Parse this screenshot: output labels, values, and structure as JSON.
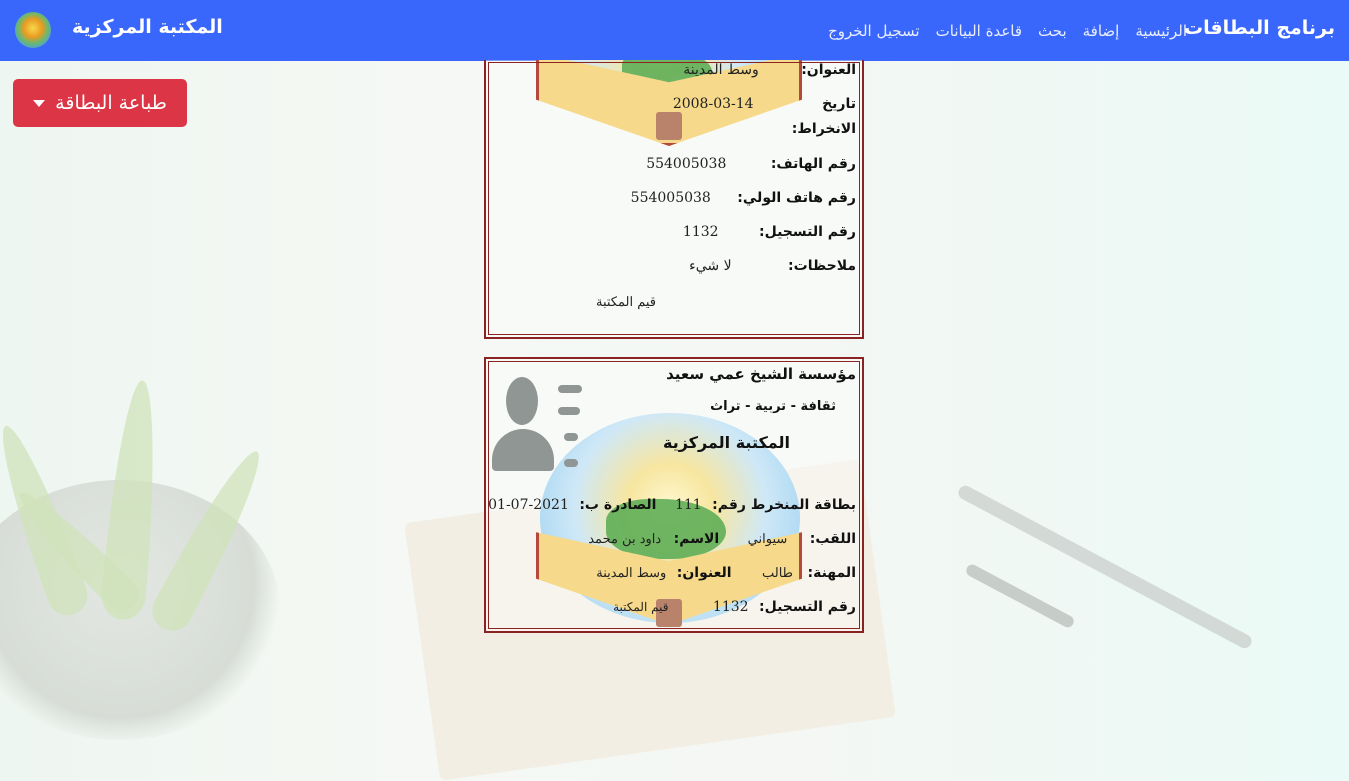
{
  "navbar": {
    "brand": "برنامج البطاقات",
    "links": [
      "الرئيسية",
      "إضافة",
      "بحث",
      "قاعدة البيانات",
      "تسجيل الخروج"
    ],
    "library_name": "المكتبة المركزية"
  },
  "print_button": {
    "label": "طباعة البطاقة"
  },
  "card1": {
    "address_label": "العنوان:",
    "address_value": "وسط المدينة",
    "join_date_label_1": "تاريخ",
    "join_date_label_2": "الانخراط:",
    "join_date_value": "2008-03-14",
    "phone_label": "رقم الهاتف:",
    "phone_value": "554005038",
    "guardian_phone_label": "رقم هاتف الولي:",
    "guardian_phone_value": "554005038",
    "registration_label": "رقم التسجيل:",
    "registration_value": "1132",
    "notes_label": "ملاحظات:",
    "notes_value": "لا شيء",
    "signature": "قيم المكتبة"
  },
  "card2": {
    "org_name": "مؤسسة الشيخ عمي سعيد",
    "org_tagline": "ثقافة - تربية - تراث",
    "library_name": "المكتبة المركزية",
    "member_card_label": "بطاقة المنخرط رقم:",
    "member_card_value": "111",
    "issued_label": "الصادرة ب:",
    "issued_value": "2021-07-01",
    "surname_label": "اللقب:",
    "surname_value": "سيواني",
    "name_label": "الاسم:",
    "name_value": "داود بن محمد",
    "profession_label": "المهنة:",
    "profession_value": "طالب",
    "address_label": "العنوان:",
    "address_value": "وسط المدينة",
    "registration_label": "رقم التسجيل:",
    "registration_value": "1132",
    "signature": "قيم المكتبة"
  },
  "colors": {
    "navbar": "#3a67fb",
    "print_button": "#dc3545",
    "card_border": "#8b2323"
  },
  "icons": {
    "logo": "library-logo",
    "caret": "caret-down-icon",
    "avatar": "user-placeholder-icon"
  }
}
